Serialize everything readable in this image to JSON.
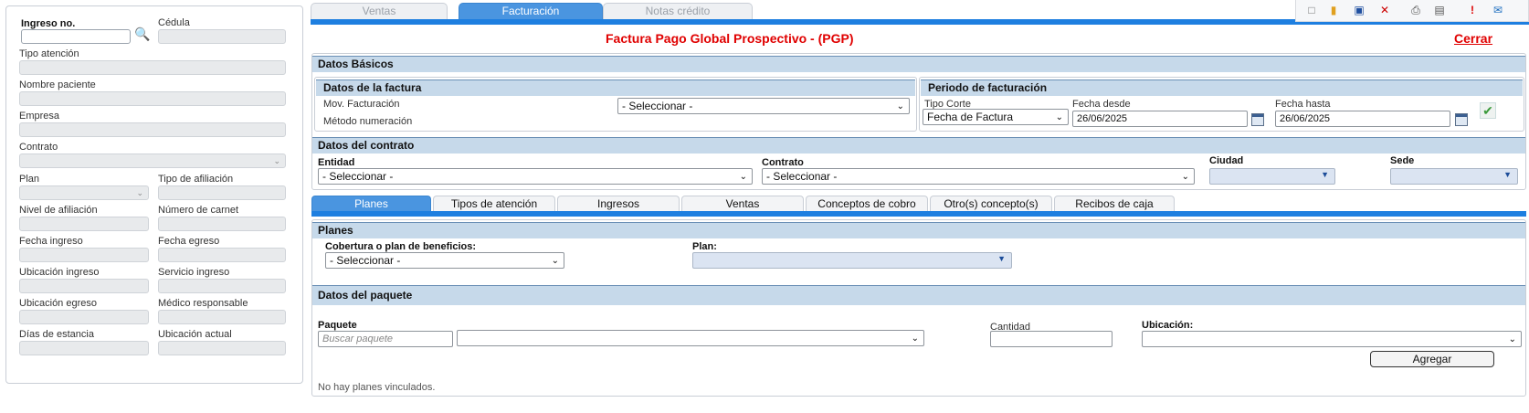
{
  "left": {
    "ingreso_label": "Ingreso no.",
    "cedula_label": "Cédula",
    "tipo_atencion_label": "Tipo atención",
    "nombre_paciente_label": "Nombre paciente",
    "empresa_label": "Empresa",
    "contrato_label": "Contrato",
    "plan_label": "Plan",
    "tipo_afiliacion_label": "Tipo de afiliación",
    "nivel_afiliacion_label": "Nivel de afiliación",
    "numero_carnet_label": "Número de carnet",
    "fecha_ingreso_label": "Fecha ingreso",
    "fecha_egreso_label": "Fecha egreso",
    "ubicacion_ingreso_label": "Ubicación ingreso",
    "servicio_ingreso_label": "Servicio ingreso",
    "ubicacion_egreso_label": "Ubicación egreso",
    "medico_responsable_label": "Médico responsable",
    "dias_estancia_label": "Días de estancia",
    "ubicacion_actual_label": "Ubicación actual"
  },
  "top_tabs": [
    "Ventas",
    "Facturación",
    "Notas crédito"
  ],
  "title": "Factura Pago Global Prospectivo - (PGP)",
  "close_label": "Cerrar",
  "datos_basicos": {
    "heading": "Datos Básicos",
    "datos_factura": {
      "heading": "Datos de la factura",
      "mov_label": "Mov. Facturación",
      "metodo_label": "Método numeración",
      "mov_value": "- Seleccionar -"
    },
    "periodo": {
      "heading": "Periodo de facturación",
      "tipo_corte_label": "Tipo Corte",
      "tipo_corte_value": "Fecha de Factura",
      "fecha_desde_label": "Fecha desde",
      "fecha_desde_value": "26/06/2025",
      "fecha_hasta_label": "Fecha hasta",
      "fecha_hasta_value": "26/06/2025"
    }
  },
  "datos_contrato": {
    "heading": "Datos del contrato",
    "entidad_label": "Entidad",
    "entidad_value": "- Seleccionar -",
    "contrato_label": "Contrato",
    "contrato_value": "- Seleccionar -",
    "ciudad_label": "Ciudad",
    "sede_label": "Sede"
  },
  "sub_tabs": [
    "Planes",
    "Tipos de atención",
    "Ingresos",
    "Ventas",
    "Conceptos de cobro",
    "Otro(s) concepto(s)",
    "Recibos de caja"
  ],
  "planes": {
    "heading": "Planes",
    "cobertura_label": "Cobertura o plan de beneficios:",
    "cobertura_value": "- Seleccionar -",
    "plan_label": "Plan:"
  },
  "paquete": {
    "heading": "Datos del paquete",
    "paquete_label": "Paquete",
    "paquete_placeholder": "Buscar paquete",
    "cantidad_label": "Cantidad",
    "ubicacion_label": "Ubicación:",
    "add_label": "Agregar",
    "empty_text": "No hay planes vinculados."
  },
  "colors": {
    "accent": "#1e7fe0",
    "title_red": "#e00000",
    "section_head": "#c6d9ea"
  }
}
